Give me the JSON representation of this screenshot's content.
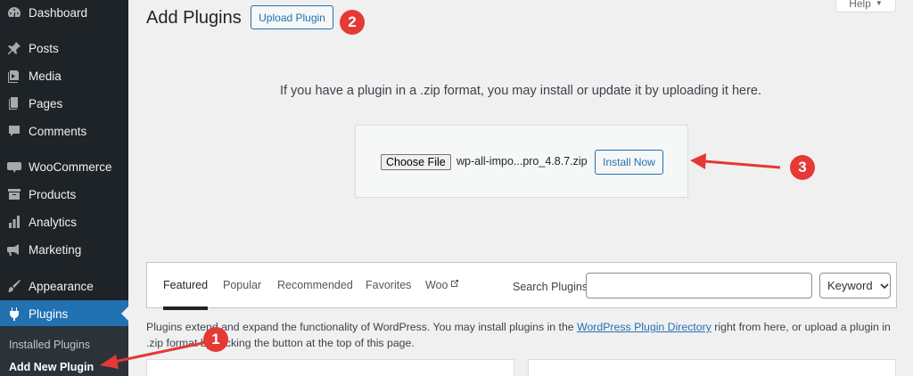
{
  "sidebar": {
    "items": [
      {
        "label": "Dashboard",
        "icon": "dashboard-icon"
      },
      {
        "label": "Posts",
        "icon": "pushpin-icon"
      },
      {
        "label": "Media",
        "icon": "media-icon"
      },
      {
        "label": "Pages",
        "icon": "pages-icon"
      },
      {
        "label": "Comments",
        "icon": "comment-icon"
      },
      {
        "label": "WooCommerce",
        "icon": "woo-icon"
      },
      {
        "label": "Products",
        "icon": "archive-icon"
      },
      {
        "label": "Analytics",
        "icon": "bar-chart-icon"
      },
      {
        "label": "Marketing",
        "icon": "megaphone-icon"
      },
      {
        "label": "Appearance",
        "icon": "brush-icon"
      },
      {
        "label": "Plugins",
        "icon": "plug-icon"
      }
    ],
    "submenu": [
      {
        "label": "Installed Plugins"
      },
      {
        "label": "Add New Plugin"
      }
    ]
  },
  "header": {
    "title": "Add Plugins",
    "upload_button": "Upload Plugin",
    "help": "Help"
  },
  "upload": {
    "instructions": "If you have a plugin in a .zip format, you may install or update it by uploading it here.",
    "choose_file": "Choose File",
    "file_name": "wp-all-impo...pro_4.8.7.zip",
    "install_button": "Install Now"
  },
  "filter": {
    "tabs": [
      "Featured",
      "Popular",
      "Recommended",
      "Favorites",
      "Woo"
    ],
    "search_label": "Search Plugins",
    "search_value": "",
    "select_value": "Keyword"
  },
  "description": {
    "before": "Plugins extend and expand the functionality of WordPress. You may install plugins in the ",
    "link": "WordPress Plugin Directory",
    "after": " right from here, or upload a plugin in .zip format by clicking the button at the top of this page."
  },
  "annotations": [
    "1",
    "2",
    "3"
  ],
  "colors": {
    "sidebar_bg": "#1d2327",
    "accent": "#2271b1",
    "annotation_red": "#e53935"
  }
}
